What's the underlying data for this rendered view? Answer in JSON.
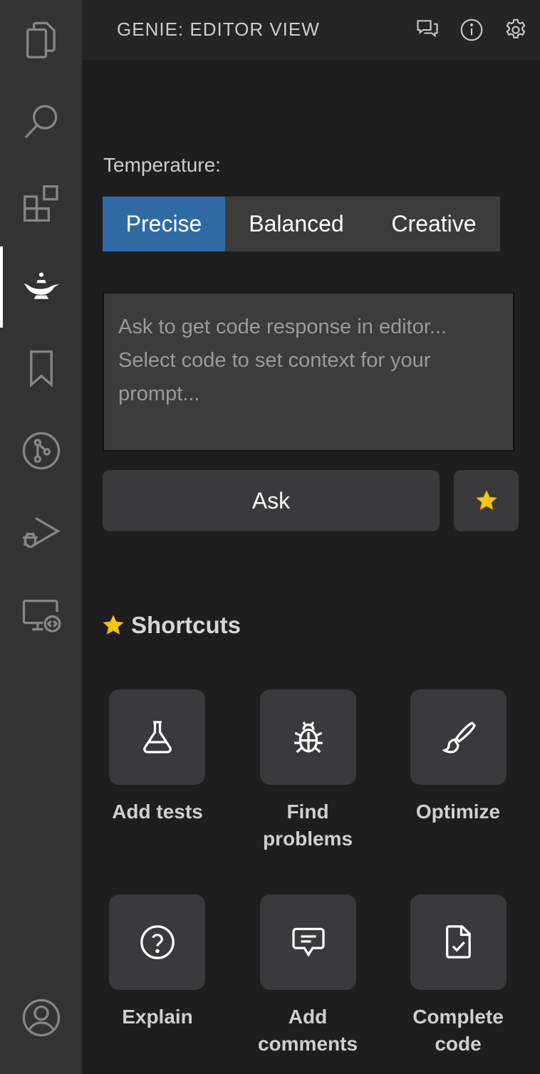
{
  "activity_bar": {
    "items": [
      {
        "name": "explorer-icon"
      },
      {
        "name": "search-icon"
      },
      {
        "name": "extensions-icon"
      },
      {
        "name": "genie-lamp-icon",
        "active": true
      },
      {
        "name": "bookmark-icon"
      },
      {
        "name": "source-control-icon"
      },
      {
        "name": "run-debug-icon"
      },
      {
        "name": "remote-explorer-icon"
      },
      {
        "name": "account-icon"
      }
    ]
  },
  "header": {
    "title": "GENIE: EDITOR VIEW",
    "icons": [
      "chat-feedback-icon",
      "info-icon",
      "settings-gear-icon"
    ]
  },
  "temperature": {
    "label": "Temperature:",
    "options": [
      "Precise",
      "Balanced",
      "Creative"
    ],
    "selected": "Precise"
  },
  "prompt": {
    "placeholder_line1": "Ask to get code response in editor...",
    "placeholder_line2": "Select code to set context for your",
    "placeholder_line3": "prompt..."
  },
  "ask": {
    "label": "Ask",
    "star_icon": "star-icon"
  },
  "shortcuts": {
    "title": "Shortcuts",
    "items": [
      {
        "icon": "flask-icon",
        "line1": "Add tests",
        "line2": ""
      },
      {
        "icon": "bug-icon",
        "line1": "Find",
        "line2": "problems"
      },
      {
        "icon": "paintbrush-icon",
        "line1": "Optimize",
        "line2": ""
      },
      {
        "icon": "question-icon",
        "line1": "Explain",
        "line2": ""
      },
      {
        "icon": "comment-icon",
        "line1": "Add",
        "line2": "comments"
      },
      {
        "icon": "file-check-icon",
        "line1": "Complete",
        "line2": "code"
      }
    ]
  },
  "colors": {
    "accent": "#2f6aa5",
    "activity_bar": "#333333",
    "panel_bg": "#1e1e1e",
    "tile_bg": "#3a3a3d",
    "star": "#f5c518"
  }
}
